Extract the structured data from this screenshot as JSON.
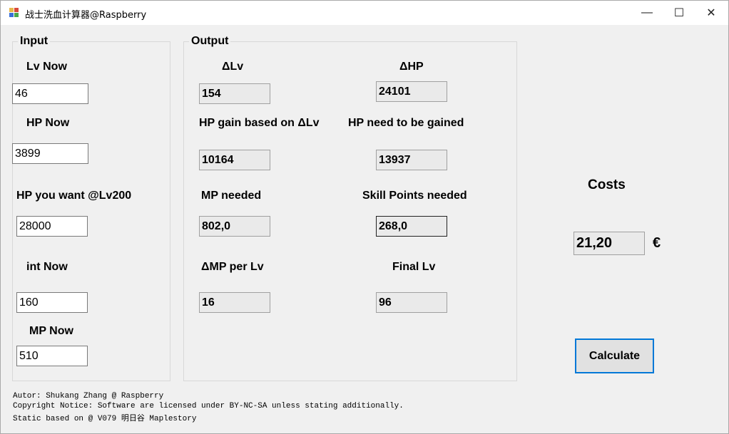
{
  "window": {
    "title": "战士洗血计算器@Raspberry",
    "controls": {
      "minimize": "—",
      "maximize": "☐",
      "close": "✕"
    }
  },
  "input": {
    "group_title": "Input",
    "lv_now_label": "Lv Now",
    "lv_now_value": "46",
    "hp_now_label": "HP Now",
    "hp_now_value": "3899",
    "hp_want_label": "HP you want @Lv200",
    "hp_want_value": "28000",
    "int_now_label": "int Now",
    "int_now_value": "160",
    "mp_now_label": "MP Now",
    "mp_now_value": "510"
  },
  "output": {
    "group_title": "Output",
    "dlv_label": "ΔLv",
    "dlv_value": "154",
    "dhp_label": "ΔHP",
    "dhp_value": "24101",
    "hp_gain_label": "HP gain based on ΔLv",
    "hp_gain_value": "10164",
    "hp_need_label": "HP need to be gained",
    "hp_need_value": "13937",
    "mp_needed_label": "MP needed",
    "mp_needed_value": "802,0",
    "sp_needed_label": "Skill Points needed",
    "sp_needed_value": "268,0",
    "dmp_label": "ΔMP per Lv",
    "dmp_value": "16",
    "final_lv_label": "Final Lv",
    "final_lv_value": "96"
  },
  "costs": {
    "label": "Costs",
    "value": "21,20",
    "currency": "€"
  },
  "calculate_button": "Calculate",
  "footer": {
    "line1": "Autor: Shukang Zhang @ Raspberry",
    "line2": "Copyright Notice: Software are licensed under BY-NC-SA unless stating additionally.",
    "line3": "Static based on @ V079 明日谷 Maplestory"
  },
  "colors": {
    "window_bg": "#f0f0f0",
    "titlebar_bg": "#ffffff",
    "button_border": "#0078d7"
  }
}
